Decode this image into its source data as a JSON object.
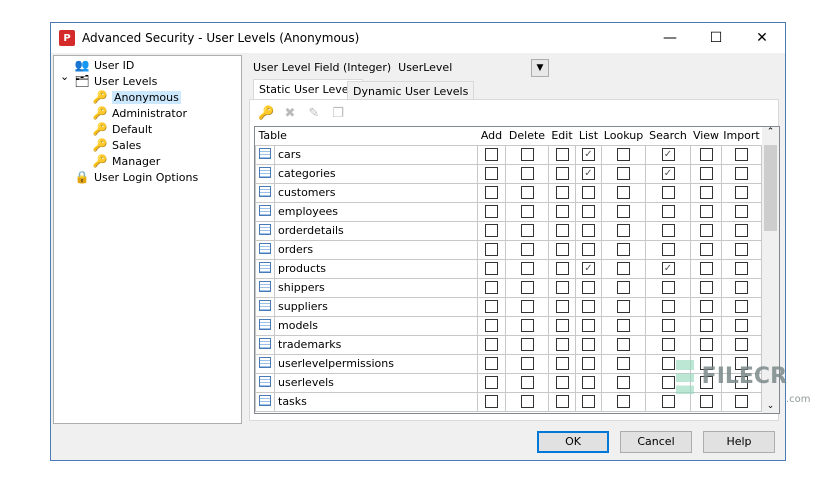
{
  "window": {
    "title": "Advanced Security - User Levels (Anonymous)",
    "minimize": "—",
    "maximize": "☐",
    "close": "✕"
  },
  "tree": [
    {
      "label": "User ID",
      "icon": "user-id-icon"
    },
    {
      "label": "User Levels",
      "icon": "user-levels-icon",
      "expanded": true
    },
    {
      "label": "Anonymous",
      "icon": "key-icon",
      "selected": true
    },
    {
      "label": "Administrator",
      "icon": "key-icon"
    },
    {
      "label": "Default",
      "icon": "key-icon"
    },
    {
      "label": "Sales",
      "icon": "key-icon"
    },
    {
      "label": "Manager",
      "icon": "key-icon"
    },
    {
      "label": "User Login Options",
      "icon": "login-options-icon"
    }
  ],
  "field": {
    "label": "User Level Field (Integer)",
    "value": "UserLevel"
  },
  "tabs": [
    {
      "label": "Static User Levels",
      "active": true
    },
    {
      "label": "Dynamic User Levels"
    }
  ],
  "grid": {
    "columns": [
      "Table",
      "Add",
      "Delete",
      "Edit",
      "List",
      "Lookup",
      "Search",
      "View",
      "Import"
    ],
    "rows": [
      {
        "name": "cars",
        "perms": [
          0,
          0,
          0,
          1,
          0,
          1,
          0,
          0
        ]
      },
      {
        "name": "categories",
        "perms": [
          0,
          0,
          0,
          1,
          0,
          1,
          0,
          0
        ]
      },
      {
        "name": "customers",
        "perms": [
          0,
          0,
          0,
          0,
          0,
          0,
          0,
          0
        ]
      },
      {
        "name": "employees",
        "perms": [
          0,
          0,
          0,
          0,
          0,
          0,
          0,
          0
        ]
      },
      {
        "name": "orderdetails",
        "perms": [
          0,
          0,
          0,
          0,
          0,
          0,
          0,
          0
        ]
      },
      {
        "name": "orders",
        "perms": [
          0,
          0,
          0,
          0,
          0,
          0,
          0,
          0
        ]
      },
      {
        "name": "products",
        "perms": [
          0,
          0,
          0,
          1,
          0,
          1,
          0,
          0
        ]
      },
      {
        "name": "shippers",
        "perms": [
          0,
          0,
          0,
          0,
          0,
          0,
          0,
          0
        ]
      },
      {
        "name": "suppliers",
        "perms": [
          0,
          0,
          0,
          0,
          0,
          0,
          0,
          0
        ]
      },
      {
        "name": "models",
        "perms": [
          0,
          0,
          0,
          0,
          0,
          0,
          0,
          0
        ]
      },
      {
        "name": "trademarks",
        "perms": [
          0,
          0,
          0,
          0,
          0,
          0,
          0,
          0
        ]
      },
      {
        "name": "userlevelpermissions",
        "perms": [
          0,
          0,
          0,
          0,
          0,
          0,
          0,
          0
        ]
      },
      {
        "name": "userlevels",
        "perms": [
          0,
          0,
          0,
          0,
          0,
          0,
          0,
          0
        ]
      },
      {
        "name": "tasks",
        "perms": [
          0,
          0,
          0,
          0,
          0,
          0,
          0,
          0
        ]
      }
    ]
  },
  "buttons": {
    "ok": "OK",
    "cancel": "Cancel",
    "help": "Help"
  },
  "watermark": {
    "text": "FILECR",
    "sub": ".com"
  }
}
